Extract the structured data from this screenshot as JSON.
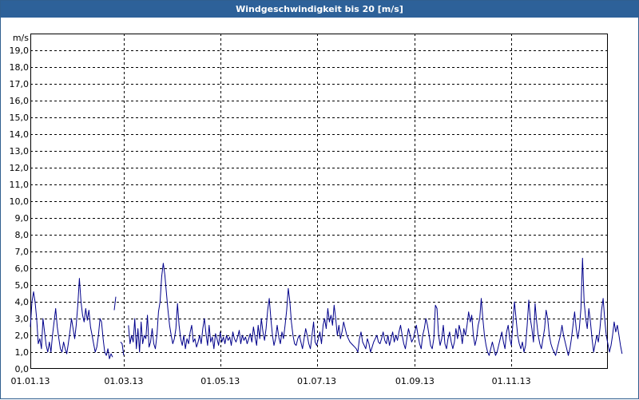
{
  "window": {
    "title": "Windgeschwindigkeit bis 20 [m/s]"
  },
  "chart_data": {
    "type": "line",
    "title": "Windgeschwindigkeit bis 20 [m/s]",
    "ylabel": "m/s",
    "xlabel": "",
    "ylim": [
      0,
      20
    ],
    "xlim": [
      "01.01.13",
      "01.01.14"
    ],
    "yticks": [
      "0,0",
      "1,0",
      "2,0",
      "3,0",
      "4,0",
      "5,0",
      "6,0",
      "7,0",
      "8,0",
      "9,0",
      "10,0",
      "11,0",
      "12,0",
      "13,0",
      "14,0",
      "15,0",
      "16,0",
      "17,0",
      "18,0",
      "19,0"
    ],
    "xticks": [
      "01.01.13",
      "01.03.13",
      "01.05.13",
      "01.07.13",
      "01.09.13",
      "01.11.13"
    ],
    "grid": true,
    "line_color": "#00008b",
    "series": [
      {
        "segments": [
          {
            "start": "2013-01-01",
            "values": [
              2.5,
              4.0,
              4.6,
              4.0,
              3.0,
              1.5,
              1.8,
              1.2,
              3.0,
              2.2,
              1.4,
              1.0,
              1.6,
              1.0,
              2.0,
              2.8,
              3.6,
              2.5,
              1.8,
              1.2,
              1.0,
              1.6,
              1.2,
              0.9,
              1.5,
              2.2,
              3.0,
              2.4,
              1.8,
              2.6,
              3.8,
              5.4,
              4.0,
              3.2,
              2.8,
              3.6,
              2.9,
              3.5,
              2.5,
              2.0,
              1.5,
              1.0,
              1.3,
              2.0,
              3.0,
              2.8,
              1.8,
              1.0,
              0.8,
              1.2,
              0.6,
              0.9,
              0.7
            ]
          },
          {
            "start": "2013-02-23",
            "values": [
              3.5,
              4.3
            ]
          },
          {
            "start": "2013-02-27",
            "values": [
              1.6,
              1.5,
              0.8
            ]
          },
          {
            "start": "2013-03-04",
            "values": [
              2.6,
              1.5,
              2.0,
              1.6,
              3.0,
              1.2,
              2.4,
              1.0,
              2.8,
              1.5,
              2.0,
              1.8,
              3.2,
              1.3,
              1.6,
              2.4,
              1.5,
              1.2,
              2.0,
              3.4,
              4.0,
              5.5,
              6.3,
              5.6,
              4.5,
              3.5,
              2.6,
              2.0,
              1.5,
              1.8,
              2.4,
              3.9,
              2.6,
              1.8,
              1.4,
              2.0,
              1.2,
              1.8,
              1.5,
              2.2,
              2.6,
              1.6,
              1.8,
              1.3,
              1.6,
              2.0,
              1.5,
              2.4,
              3.0,
              2.1,
              1.4,
              2.6,
              1.6,
              1.9,
              1.2,
              2.1,
              1.8,
              1.4,
              2.2,
              1.6,
              1.9,
              1.5,
              2.0,
              1.7,
              1.9,
              1.4,
              2.2,
              1.8,
              1.6,
              1.9,
              2.3,
              1.5,
              2.0,
              1.7,
              1.9,
              1.5,
              1.8,
              2.1,
              1.6,
              2.5,
              1.9,
              1.4,
              2.6,
              1.8,
              3.0,
              2.2,
              1.7,
              2.4,
              3.5,
              4.2,
              3.0,
              2.0,
              1.4,
              1.8,
              2.6,
              1.9,
              1.5,
              2.2,
              1.8,
              2.6,
              3.5,
              4.8,
              4.0,
              2.8,
              2.0,
              1.5,
              1.4,
              1.8,
              2.0,
              1.6,
              1.2,
              1.8,
              2.4,
              2.0,
              1.5,
              1.2,
              2.0,
              2.8,
              1.6,
              1.4,
              1.8,
              2.2,
              1.5,
              2.6,
              3.0,
              2.4,
              3.6,
              2.8,
              3.2,
              2.6,
              3.8,
              3.0,
              2.0,
              2.6,
              1.8,
              2.2,
              2.8,
              2.4,
              2.0,
              1.8,
              1.6,
              1.5,
              1.4,
              1.3,
              1.2,
              1.0,
              1.8,
              2.2,
              1.6,
              1.4,
              1.2,
              1.8,
              1.5,
              1.0,
              1.3,
              1.6,
              1.8,
              2.0,
              1.6,
              1.5,
              1.8,
              2.2,
              1.7,
              1.5,
              2.0,
              1.4,
              1.8,
              2.2,
              1.6,
              2.0,
              1.7,
              2.2,
              2.6,
              2.0,
              1.5,
              1.2,
              1.8,
              2.4,
              2.0,
              1.6,
              1.8,
              2.2,
              2.6,
              2.0,
              1.5,
              1.2,
              2.0,
              2.4,
              3.0,
              2.6,
              2.0,
              1.4,
              1.2,
              1.8,
              3.8,
              3.6,
              2.0,
              1.4,
              1.8,
              2.6,
              1.5,
              1.2,
              1.8,
              2.2,
              1.6,
              1.2,
              1.6,
              2.4,
              1.8,
              2.6,
              2.2,
              1.5,
              2.4,
              2.0,
              2.6,
              3.4,
              2.8,
              3.2,
              2.0,
              1.4,
              1.8,
              2.6,
              3.0,
              4.2,
              3.0,
              2.0,
              1.4,
              1.0,
              0.8,
              1.2,
              1.6,
              1.2,
              0.8,
              1.0,
              1.4,
              1.8,
              2.2,
              1.6,
              1.2,
              2.2,
              2.6,
              1.8,
              1.4,
              2.8,
              4.0,
              3.0,
              2.0,
              1.5,
              1.2,
              1.6,
              1.0,
              1.4,
              2.6,
              4.1,
              3.0,
              2.4,
              1.6,
              3.9,
              2.8,
              2.0,
              1.5,
              1.2,
              1.8,
              2.4,
              3.5,
              3.0,
              2.0,
              1.5,
              1.2,
              1.0,
              0.8,
              1.2,
              1.6,
              2.0,
              2.6,
              2.0,
              1.6,
              1.2,
              0.8,
              1.2,
              1.8,
              2.6,
              3.4,
              2.4,
              1.8,
              2.4,
              3.6,
              6.6,
              4.0,
              3.0,
              2.4,
              3.6,
              2.8,
              1.8,
              1.0,
              1.5,
              2.0,
              1.6,
              2.4,
              3.5,
              4.2,
              3.0,
              2.0,
              1.5,
              1.0,
              1.4,
              2.0,
              2.8,
              2.2,
              2.6,
              2.0,
              1.4,
              0.9
            ]
          }
        ]
      }
    ]
  }
}
